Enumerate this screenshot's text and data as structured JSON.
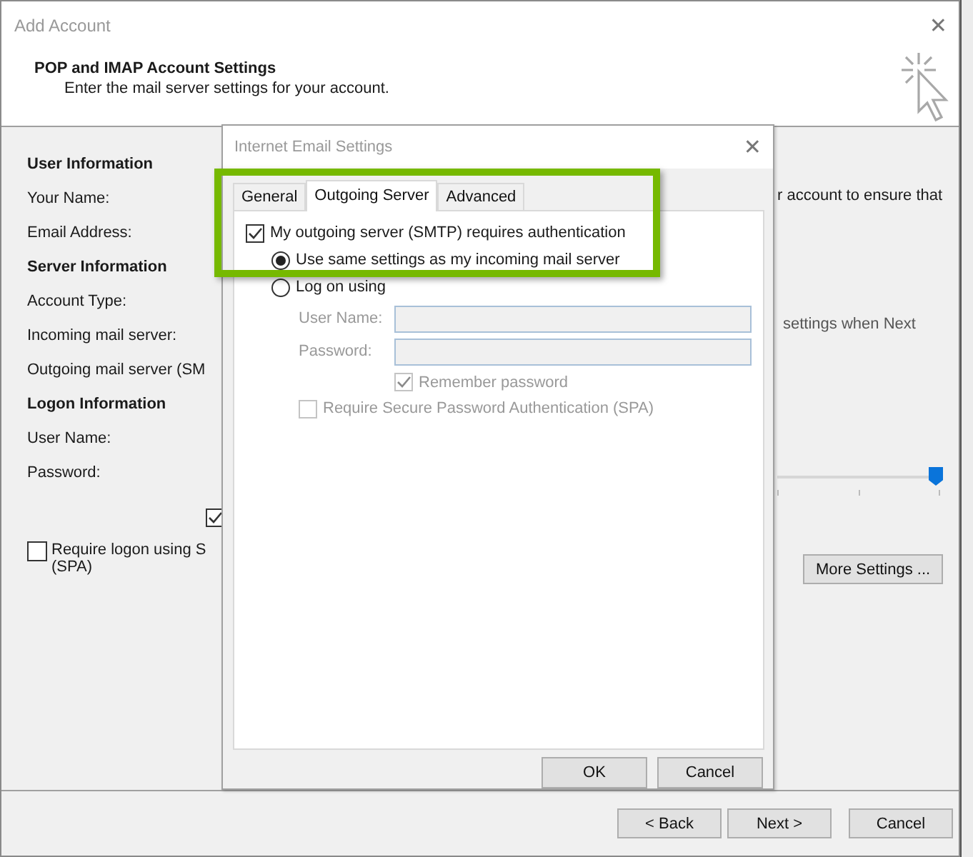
{
  "window": {
    "title": "Add Account",
    "close": "✕"
  },
  "header": {
    "title": "POP and IMAP Account Settings",
    "subtitle": "Enter the mail server settings for your account."
  },
  "sections": [
    {
      "heading": "User Information",
      "labels": [
        "Your Name:",
        "Email Address:"
      ]
    },
    {
      "heading": "Server Information",
      "labels": [
        "Account Type:",
        "Incoming mail server:",
        "Outgoing mail server (SM"
      ]
    },
    {
      "heading": "Logon Information",
      "labels": [
        "User Name:",
        "Password:"
      ]
    }
  ],
  "remember_checkbox": {
    "checked": true
  },
  "spa_checkbox": {
    "label": "Require logon using S",
    "label_line2": "(SPA)",
    "checked": false
  },
  "right_texts": [
    "r account to ensure that",
    "settings when Next"
  ],
  "slider": {
    "level": 1
  },
  "more_settings_button": "More Settings ...",
  "buttons": [
    "< Back",
    "Next >",
    "Cancel"
  ],
  "dialog": {
    "title": "Internet Email Settings",
    "close": "✕",
    "tabs": [
      {
        "label": "General",
        "selected": false
      },
      {
        "label": "Outgoing Server",
        "selected": true
      },
      {
        "label": "Advanced",
        "selected": false
      }
    ],
    "smtp_auth": {
      "label": "My outgoing server (SMTP) requires authentication",
      "checked": true
    },
    "options": [
      {
        "label": "Use same settings as my incoming mail server",
        "selected": true
      },
      {
        "label": "Log on using",
        "selected": false
      }
    ],
    "user_name_label": "User Name:",
    "password_label": "Password:",
    "remember": {
      "label": "Remember password",
      "checked": true,
      "disabled": true
    },
    "spa": {
      "label": "Require Secure Password Authentication (SPA)",
      "checked": false,
      "disabled": true
    },
    "buttons": [
      "OK",
      "Cancel"
    ]
  }
}
